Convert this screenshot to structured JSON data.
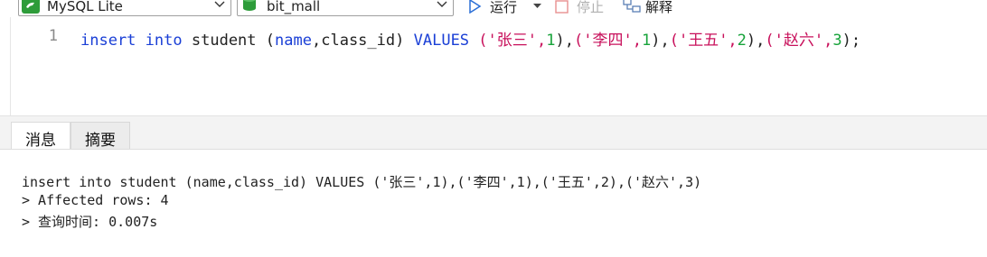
{
  "toolbar": {
    "connection_label": "MySQL Lite",
    "database_label": "bit_mall",
    "run_label": "运行",
    "stop_label": "停止",
    "explain_label": "解释"
  },
  "editor": {
    "line_number": "1",
    "tokens": {
      "kw_insert": "insert",
      "kw_into": "into",
      "table": "student",
      "open_paren": "(",
      "col_name": "name",
      "comma1": ",",
      "col_class": "class_id",
      "close_paren": ")",
      "kw_values": "VALUES",
      "p1_open": "('",
      "s1": "张三",
      "p1_mid": "',",
      "n1": "1",
      "p1_close": "),",
      "p2_open": "('",
      "s2": "李四",
      "p2_mid": "',",
      "n2": "1",
      "p2_close": "),",
      "p3_open": "('",
      "s3": "王五",
      "p3_mid": "',",
      "n3": "2",
      "p3_close": "),",
      "p4_open": "('",
      "s4": "赵六",
      "p4_mid": "',",
      "n4": "3",
      "p4_close": ");"
    }
  },
  "tabs": [
    {
      "label": "消息"
    },
    {
      "label": "摘要"
    }
  ],
  "messages": {
    "line1": "insert into student (name,class_id) VALUES ('张三',1),('李四',1),('王五',2),('赵六',3)",
    "line2": "> Affected rows: 4",
    "line3": "> 查询时间: 0.007s"
  },
  "colors": {
    "keyword": "#1a3fd6",
    "string": "#c8105b",
    "number": "#17a33a",
    "connection_icon": "#2e9c3a"
  },
  "icons": {
    "connection": "mysql-connection-icon",
    "database": "database-icon",
    "run": "play-icon",
    "stop": "stop-icon",
    "explain": "explain-icon"
  }
}
